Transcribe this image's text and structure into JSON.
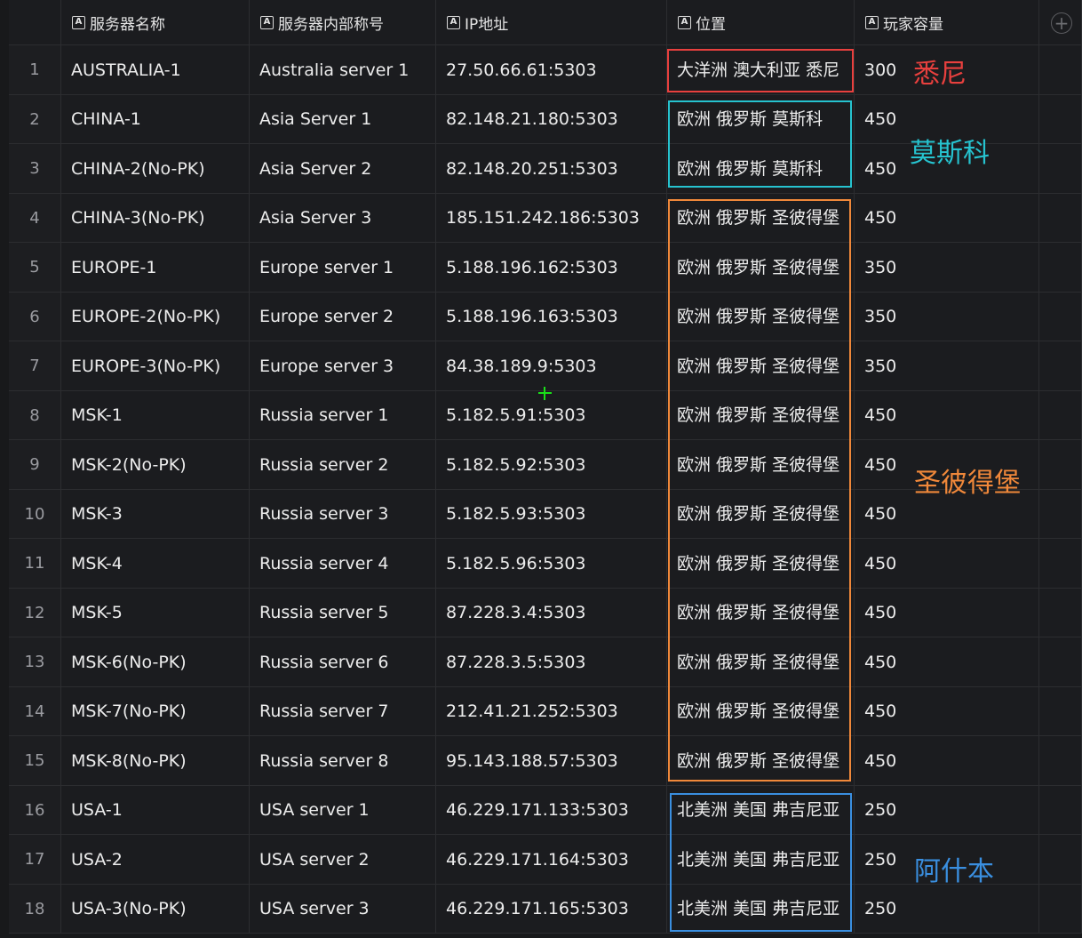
{
  "table": {
    "columns": [
      {
        "name": "server-name",
        "label": "服务器名称"
      },
      {
        "name": "internal-name",
        "label": "服务器内部称号"
      },
      {
        "name": "ip-address",
        "label": "IP地址"
      },
      {
        "name": "location",
        "label": "位置"
      },
      {
        "name": "capacity",
        "label": "玩家容量"
      }
    ],
    "rows": [
      {
        "no": "1",
        "cells": [
          "AUSTRALIA-1",
          "Australia server 1",
          "27.50.66.61:5303",
          "大洋洲 澳大利亚 悉尼",
          "300"
        ]
      },
      {
        "no": "2",
        "cells": [
          "CHINA-1",
          "Asia Server 1",
          "82.148.21.180:5303",
          "欧洲 俄罗斯 莫斯科",
          "450"
        ]
      },
      {
        "no": "3",
        "cells": [
          "CHINA-2(No-PK)",
          "Asia Server 2",
          "82.148.20.251:5303",
          "欧洲 俄罗斯 莫斯科",
          "450"
        ]
      },
      {
        "no": "4",
        "cells": [
          "CHINA-3(No-PK)",
          "Asia Server 3",
          "185.151.242.186:5303",
          "欧洲 俄罗斯 圣彼得堡",
          "450"
        ]
      },
      {
        "no": "5",
        "cells": [
          "EUROPE-1",
          "Europe server 1",
          "5.188.196.162:5303",
          "欧洲 俄罗斯 圣彼得堡",
          "350"
        ]
      },
      {
        "no": "6",
        "cells": [
          "EUROPE-2(No-PK)",
          "Europe server 2",
          "5.188.196.163:5303",
          "欧洲 俄罗斯 圣彼得堡",
          "350"
        ]
      },
      {
        "no": "7",
        "cells": [
          "EUROPE-3(No-PK)",
          "Europe server 3",
          "84.38.189.9:5303",
          "欧洲 俄罗斯 圣彼得堡",
          "350"
        ]
      },
      {
        "no": "8",
        "cells": [
          "MSK-1",
          "Russia server 1",
          "5.182.5.91:5303",
          "欧洲 俄罗斯 圣彼得堡",
          "450"
        ]
      },
      {
        "no": "9",
        "cells": [
          "MSK-2(No-PK)",
          "Russia server 2",
          "5.182.5.92:5303",
          "欧洲 俄罗斯 圣彼得堡",
          "450"
        ]
      },
      {
        "no": "10",
        "cells": [
          "MSK-3",
          "Russia server 3",
          "5.182.5.93:5303",
          "欧洲 俄罗斯 圣彼得堡",
          "450"
        ]
      },
      {
        "no": "11",
        "cells": [
          "MSK-4",
          "Russia server 4",
          "5.182.5.96:5303",
          "欧洲 俄罗斯 圣彼得堡",
          "450"
        ]
      },
      {
        "no": "12",
        "cells": [
          "MSK-5",
          "Russia server 5",
          "87.228.3.4:5303",
          "欧洲 俄罗斯 圣彼得堡",
          "450"
        ]
      },
      {
        "no": "13",
        "cells": [
          "MSK-6(No-PK)",
          "Russia server 6",
          "87.228.3.5:5303",
          "欧洲 俄罗斯 圣彼得堡",
          "450"
        ]
      },
      {
        "no": "14",
        "cells": [
          "MSK-7(No-PK)",
          "Russia server 7",
          "212.41.21.252:5303",
          "欧洲 俄罗斯 圣彼得堡",
          "450"
        ]
      },
      {
        "no": "15",
        "cells": [
          "MSK-8(No-PK)",
          "Russia server 8",
          "95.143.188.57:5303",
          "欧洲 俄罗斯 圣彼得堡",
          "450"
        ]
      },
      {
        "no": "16",
        "cells": [
          "USA-1",
          "USA  server 1",
          "46.229.171.133:5303",
          "北美洲 美国 弗吉尼亚",
          "250"
        ]
      },
      {
        "no": "17",
        "cells": [
          "USA-2",
          "USA  server 2",
          "46.229.171.164:5303",
          "北美洲 美国 弗吉尼亚",
          "250"
        ]
      },
      {
        "no": "18",
        "cells": [
          "USA-3(No-PK)",
          "USA  server 3",
          "46.229.171.165:5303",
          "北美洲 美国 弗吉尼亚",
          "250"
        ]
      }
    ]
  },
  "annotations": [
    {
      "name": "annotation-sydney",
      "label": "悉尼",
      "color": "#e8403e"
    },
    {
      "name": "annotation-moscow",
      "label": "莫斯科",
      "color": "#26c3cf"
    },
    {
      "name": "annotation-saint-petersburg",
      "label": "圣彼得堡",
      "color": "#f0883a"
    },
    {
      "name": "annotation-ashburn",
      "label": "阿什本",
      "color": "#3a8fe0"
    }
  ],
  "icons": {
    "column_type": "text-field-icon",
    "add_column": "plus-circle-icon"
  }
}
